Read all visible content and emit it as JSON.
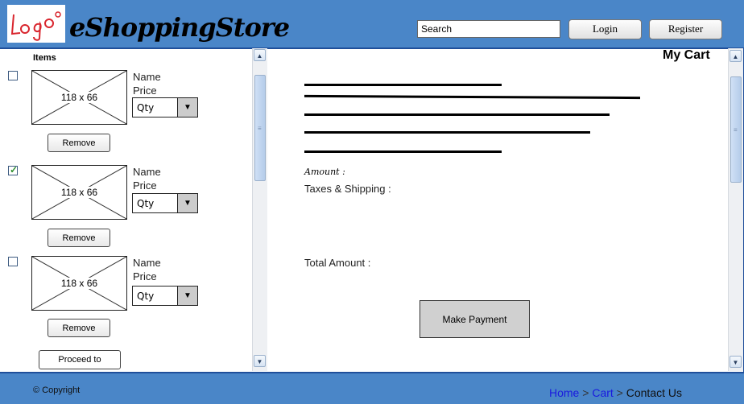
{
  "header": {
    "logo_text": "Logo",
    "brand": "eShoppingStore",
    "search_value": "Search",
    "login_label": "Login",
    "register_label": "Register"
  },
  "items_panel": {
    "title": "Items",
    "items": [
      {
        "checked": false,
        "image_label": "118 x 66",
        "name": "Name",
        "price": "Price",
        "qty": "Qty",
        "remove_label": "Remove"
      },
      {
        "checked": true,
        "image_label": "118 x 66",
        "name": "Name",
        "price": "Price",
        "qty": "Qty",
        "remove_label": "Remove"
      },
      {
        "checked": false,
        "image_label": "118 x 66",
        "name": "Name",
        "price": "Price",
        "qty": "Qty",
        "remove_label": "Remove"
      }
    ],
    "checkout_label": "Proceed to checkout"
  },
  "cart": {
    "title": "My Cart",
    "amount_label": "Amount :",
    "taxes_label": "Taxes & Shipping :",
    "total_label": "Total Amount :",
    "pay_label": "Make Payment"
  },
  "footer": {
    "copyright": "© Copyright",
    "breadcrumb": [
      "Home",
      "Cart",
      "Contact Us"
    ],
    "separator": ">"
  },
  "colors": {
    "header_bg": "#4a86c8",
    "border": "#1f4f9a",
    "link": "#1a1adf",
    "logo_red": "#d9262e"
  }
}
